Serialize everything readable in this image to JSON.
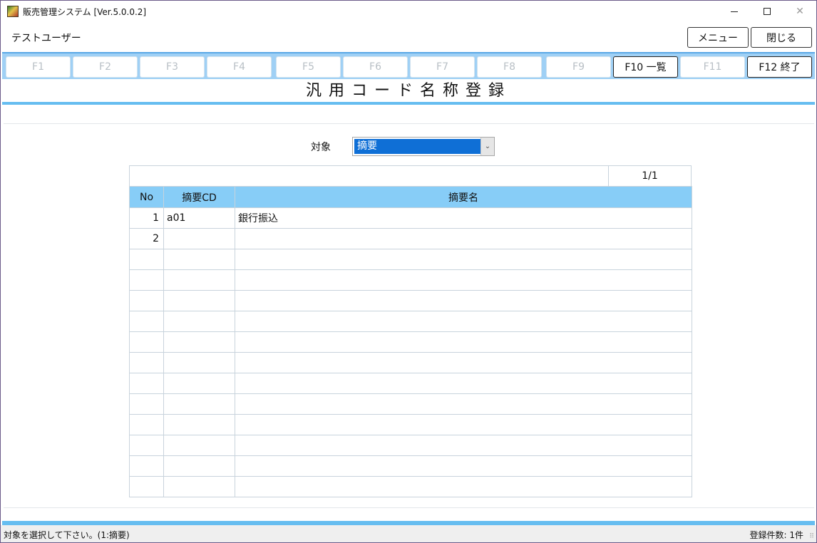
{
  "window": {
    "title": "販売管理システム [Ver.5.0.0.2]",
    "minimize": "—",
    "close": "✕"
  },
  "header": {
    "user": "テストユーザー",
    "menu_label": "メニュー",
    "close_label": "閉じる"
  },
  "fkeys": [
    {
      "label": "F1",
      "enabled": false
    },
    {
      "label": "F2",
      "enabled": false
    },
    {
      "label": "F3",
      "enabled": false
    },
    {
      "label": "F4",
      "enabled": false
    },
    {
      "label": "F5",
      "enabled": false
    },
    {
      "label": "F6",
      "enabled": false
    },
    {
      "label": "F7",
      "enabled": false
    },
    {
      "label": "F8",
      "enabled": false
    },
    {
      "label": "F9",
      "enabled": false
    },
    {
      "label": "F10 一覧",
      "enabled": true
    },
    {
      "label": "F11",
      "enabled": false
    },
    {
      "label": "F12 終了",
      "enabled": true
    }
  ],
  "screen_title": "汎用コード名称登録",
  "target": {
    "label": "対象",
    "selected": "摘要"
  },
  "grid": {
    "page": "1/1",
    "headers": [
      "No",
      "摘要CD",
      "摘要名"
    ],
    "rows": [
      [
        "1",
        "a01",
        "銀行振込"
      ],
      [
        "2",
        "",
        ""
      ],
      [
        "",
        "",
        ""
      ],
      [
        "",
        "",
        ""
      ],
      [
        "",
        "",
        ""
      ],
      [
        "",
        "",
        ""
      ],
      [
        "",
        "",
        ""
      ],
      [
        "",
        "",
        ""
      ],
      [
        "",
        "",
        ""
      ],
      [
        "",
        "",
        ""
      ],
      [
        "",
        "",
        ""
      ],
      [
        "",
        "",
        ""
      ],
      [
        "",
        "",
        ""
      ],
      [
        "",
        "",
        ""
      ]
    ]
  },
  "status": {
    "message": "対象を選択して下さい。(1:摘要)",
    "count": "登録件数: 1件"
  },
  "colors": {
    "accent": "#66bdf0",
    "header_fill": "#87cdf7",
    "selection": "#0f6fd6"
  }
}
